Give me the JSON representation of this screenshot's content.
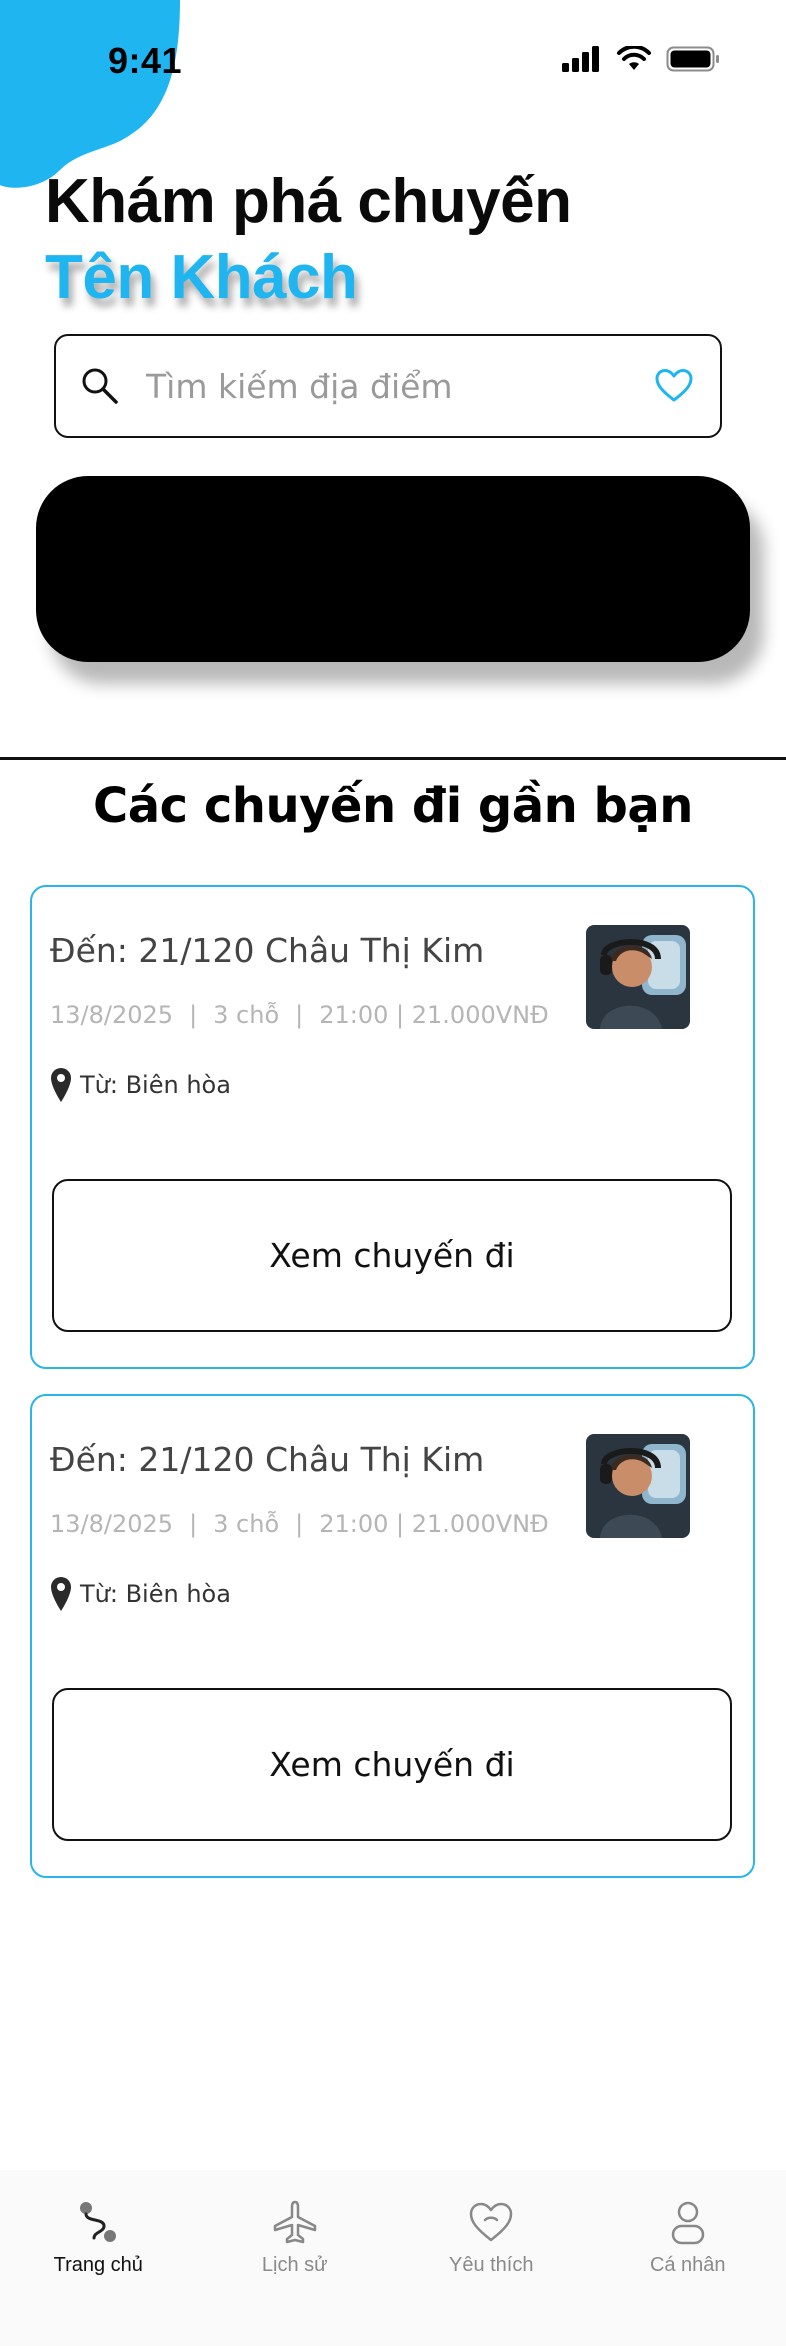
{
  "status_bar": {
    "time": "9:41"
  },
  "header": {
    "title": "Khám phá chuyến",
    "user_name": "Tên Khách"
  },
  "search": {
    "placeholder": "Tìm kiếm địa điểm"
  },
  "section": {
    "title": "Các chuyến đi gần bạn"
  },
  "trips": [
    {
      "destination": "Đến: 21/120 Châu Thị Kim",
      "date": "13/8/2025",
      "seats": "3 chỗ",
      "time_price": "21:00 | 21.000VNĐ",
      "from": "Từ: Biên hòa",
      "button_label": "Xem chuyến đi"
    },
    {
      "destination": "Đến: 21/120 Châu Thị Kim",
      "date": "13/8/2025",
      "seats": "3 chỗ",
      "time_price": "21:00 | 21.000VNĐ",
      "from": "Từ: Biên hòa",
      "button_label": "Xem chuyến đi"
    }
  ],
  "bottom_nav": {
    "items": [
      {
        "label": "Trang chủ",
        "icon": "route-icon",
        "active": true
      },
      {
        "label": "Lịch sử",
        "icon": "airplane-icon",
        "active": false
      },
      {
        "label": "Yêu thích",
        "icon": "heart-icon",
        "active": false
      },
      {
        "label": "Cá nhân",
        "icon": "person-icon",
        "active": false
      }
    ]
  },
  "colors": {
    "accent": "#1fb5f1",
    "card_border": "#29b4ec",
    "banner": "#000000"
  }
}
